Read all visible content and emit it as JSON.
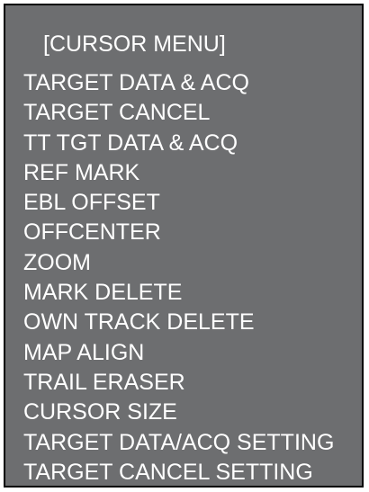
{
  "menu": {
    "title": "[CURSOR MENU]",
    "items": [
      {
        "label": "TARGET DATA & ACQ"
      },
      {
        "label": "TARGET CANCEL"
      },
      {
        "label": "TT TGT DATA & ACQ"
      },
      {
        "label": "REF MARK"
      },
      {
        "label": "EBL OFFSET"
      },
      {
        "label": "OFFCENTER"
      },
      {
        "label": "ZOOM"
      },
      {
        "label": "MARK DELETE"
      },
      {
        "label": "OWN TRACK DELETE"
      },
      {
        "label": "MAP ALIGN"
      },
      {
        "label": "TRAIL ERASER"
      },
      {
        "label": "CURSOR SIZE"
      },
      {
        "label": "TARGET DATA/ACQ SETTING"
      },
      {
        "label": "TARGET CANCEL SETTING"
      }
    ]
  },
  "colors": {
    "panel_background": "#6d6e70",
    "text": "#ffffff",
    "border": "#000000"
  }
}
